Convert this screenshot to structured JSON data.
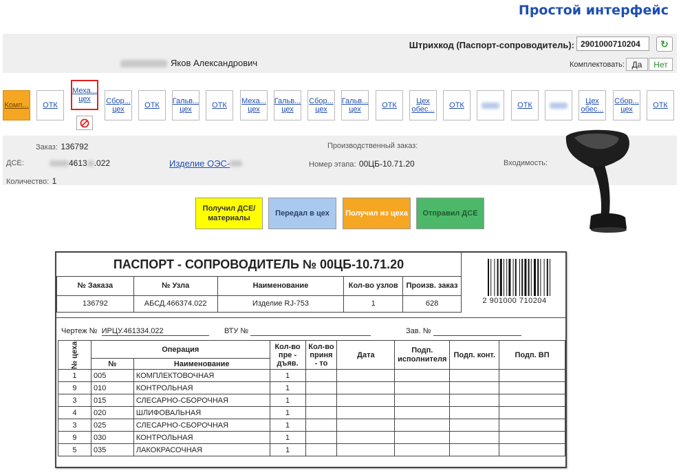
{
  "header": {
    "title": "Простой интерфейс"
  },
  "barcode": {
    "label": "Штрихкод (Паспорт-сопроводитель):",
    "value": "2901000710204"
  },
  "user": {
    "name_visible": "Яков Александрович"
  },
  "kompl": {
    "label": "Комплектовать:",
    "yes": "Да",
    "no": "Нет"
  },
  "route": [
    {
      "label": "Комп...",
      "state": "active"
    },
    {
      "label": "ОТК",
      "state": "normal"
    },
    {
      "label": "Меха... цех",
      "state": "selected"
    },
    {
      "label": "Сбор... цех",
      "state": "normal"
    },
    {
      "label": "ОТК",
      "state": "normal"
    },
    {
      "label": "Гальв... цех",
      "state": "normal"
    },
    {
      "label": "ОТК",
      "state": "normal"
    },
    {
      "label": "Меха... цех",
      "state": "normal"
    },
    {
      "label": "Гальв... цех",
      "state": "normal"
    },
    {
      "label": "Сбор... цех",
      "state": "normal"
    },
    {
      "label": "Гальв... цех",
      "state": "normal"
    },
    {
      "label": "ОТК",
      "state": "normal"
    },
    {
      "label": "Цех обес...",
      "state": "normal"
    },
    {
      "label": "ОТК",
      "state": "normal"
    },
    {
      "label": "",
      "state": "blurred"
    },
    {
      "label": "ОТК",
      "state": "normal"
    },
    {
      "label": "",
      "state": "blurred"
    },
    {
      "label": "Цех обес...",
      "state": "normal"
    },
    {
      "label": "Сбор... цех",
      "state": "normal"
    },
    {
      "label": "ОТК",
      "state": "normal"
    }
  ],
  "info": {
    "order_label": "Заказ:",
    "order_value": "136792",
    "dse_label": "ДСЕ:",
    "dse_value_a": "4613",
    "dse_value_b": ".022",
    "product_link": "Изделие ОЭС-",
    "qty_label": "Количество:",
    "qty_value": "1",
    "prod_order_label": "Производственный заказ:",
    "stage_label": "Номер этапа:",
    "stage_value": "00ЦБ-10.71.20",
    "incoming_label": "Входимость:"
  },
  "actions": [
    {
      "label": "Получил ДСЕ/ материалы",
      "color": "#ffff00"
    },
    {
      "label": "Передал в цех",
      "color": "#a9c9ee"
    },
    {
      "label": "Получил из цеха",
      "color": "#f5a623"
    },
    {
      "label": "Отправил ДСЕ",
      "color": "#4db86a"
    }
  ],
  "doc": {
    "title": "ПАСПОРТ - СОПРОВОДИТЕЛЬ № 00ЦБ-10.71.20",
    "head_cols": [
      "№ Заказа",
      "№ Узла",
      "Наименование",
      "Кол-во узлов",
      "Произв. заказ"
    ],
    "head_vals": [
      "136792",
      "АБСД.466374.022",
      "Изделие RJ-753",
      "1",
      "628"
    ],
    "barcode_text": "2 901000 710204",
    "drawing_label": "Чертеж №",
    "drawing_value": "ИРЦУ.461334.022",
    "vtu_label": "ВТУ №",
    "zav_label": "Зав. №",
    "col_shop": "№ цеха",
    "col_operation": "Операция",
    "col_num": "№",
    "col_name": "Наименование",
    "col_presented": "Кол-во пре - дъяв.",
    "col_accepted": "Кол-во приня - то",
    "col_date": "Дата",
    "col_exec": "Подп. исполнителя",
    "col_ctrl": "Подп. конт.",
    "col_vp": "Подп. ВП",
    "rows": [
      {
        "shop": "1",
        "num": "005",
        "name": "КОМПЛЕКТОВОЧНАЯ",
        "qty": "1"
      },
      {
        "shop": "9",
        "num": "010",
        "name": "КОНТРОЛЬНАЯ",
        "qty": "1"
      },
      {
        "shop": "3",
        "num": "015",
        "name": "СЛЕСАРНО-СБОРОЧНАЯ",
        "qty": "1"
      },
      {
        "shop": "4",
        "num": "020",
        "name": "ШЛИФОВАЛЬНАЯ",
        "qty": "1"
      },
      {
        "shop": "3",
        "num": "025",
        "name": "СЛЕСАРНО-СБОРОЧНАЯ",
        "qty": "1"
      },
      {
        "shop": "9",
        "num": "030",
        "name": "КОНТРОЛЬНАЯ",
        "qty": "1"
      },
      {
        "shop": "5",
        "num": "035",
        "name": "ЛАКОКРАСОЧНАЯ",
        "qty": "1"
      }
    ]
  }
}
